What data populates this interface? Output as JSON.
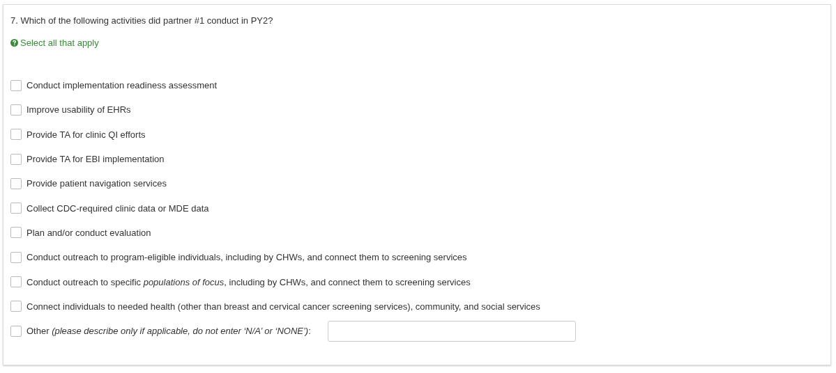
{
  "question": {
    "title": "7. Which of the following activities did partner #1 conduct in PY2?",
    "hint": "Select all that apply"
  },
  "options": [
    {
      "kind": "checkbox",
      "label": "Conduct implementation readiness assessment",
      "checked": false
    },
    {
      "kind": "checkbox",
      "label": "Improve usability of EHRs",
      "checked": false
    },
    {
      "kind": "checkbox",
      "label": "Provide TA for clinic QI efforts",
      "checked": false
    },
    {
      "kind": "checkbox",
      "label": "Provide TA for EBI implementation",
      "checked": false
    },
    {
      "kind": "checkbox",
      "label": "Provide patient navigation services",
      "checked": false
    },
    {
      "kind": "checkbox",
      "label": "Collect CDC-required clinic data or MDE data",
      "checked": false
    },
    {
      "kind": "checkbox",
      "label": "Plan and/or conduct evaluation",
      "checked": false
    },
    {
      "kind": "checkbox",
      "label": "Conduct outreach to program-eligible individuals, including by CHWs, and connect them to screening services",
      "checked": false
    },
    {
      "kind": "checkbox",
      "label": "Conduct outreach to specific *populations of focus*, including by CHWs, and connect them to screening services",
      "checked": false
    },
    {
      "kind": "checkbox",
      "label": "Connect individuals to needed health (other than breast and cervical cancer screening services), community, and social services",
      "checked": false
    },
    {
      "kind": "other",
      "label": "Other *(please describe only if applicable, do not enter ‘N/A’ or ‘NONE’)*:",
      "checked": false
    }
  ]
}
